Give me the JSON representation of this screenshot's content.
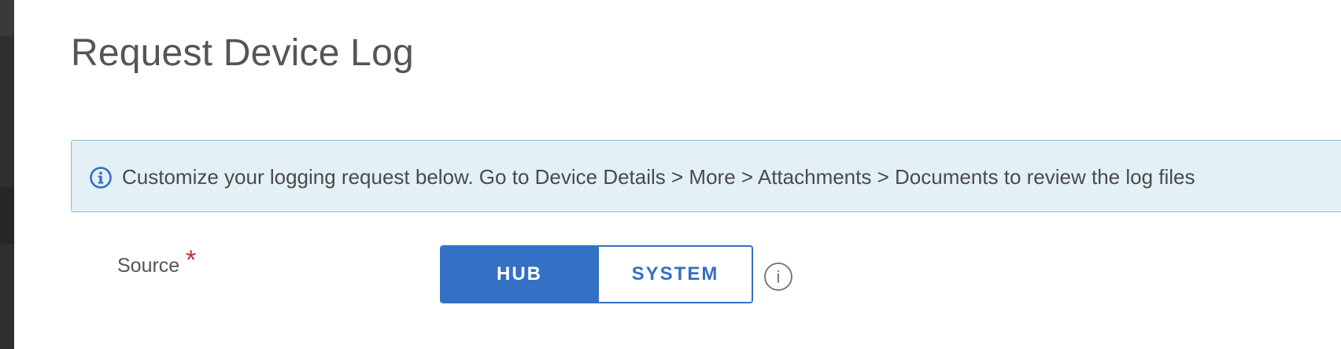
{
  "dialog": {
    "title": "Request Device Log"
  },
  "info_banner": {
    "icon": "info-circle-icon",
    "message": "Customize your logging request below. Go to Device Details > More > Attachments > Documents to review the log files",
    "accent_color": "#3470c4",
    "background_color": "#e3f0f6"
  },
  "source_field": {
    "label": "Source",
    "required_marker": "*",
    "options": [
      {
        "label": "HUB",
        "selected": true
      },
      {
        "label": "SYSTEM",
        "selected": false
      }
    ],
    "help_icon": "info-outline-icon",
    "help_glyph": "i",
    "accent_color": "#3470c4",
    "required_color": "#b8322a"
  }
}
